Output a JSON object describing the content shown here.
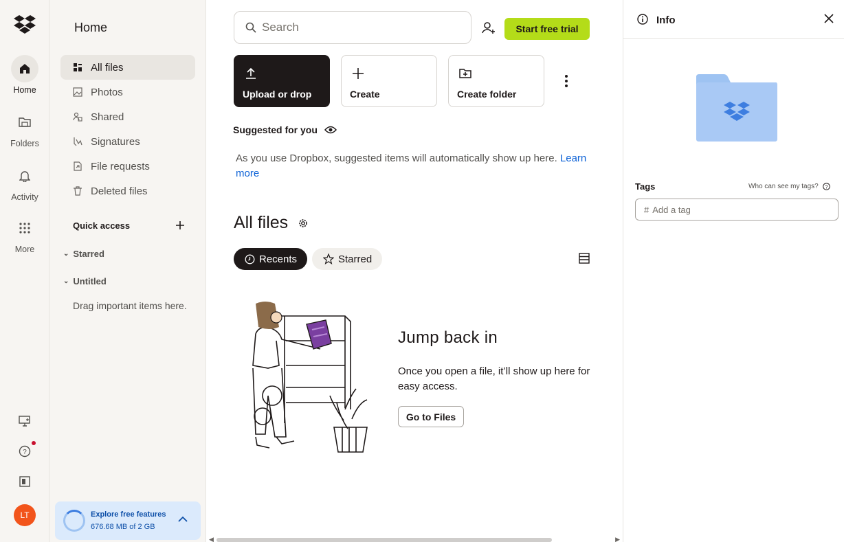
{
  "rail": {
    "items": [
      {
        "label": "Home",
        "icon": "home-icon"
      },
      {
        "label": "Folders",
        "icon": "folders-icon"
      },
      {
        "label": "Activity",
        "icon": "bell-icon"
      },
      {
        "label": "More",
        "icon": "grid-icon"
      }
    ],
    "avatar_initials": "LT"
  },
  "sidebar": {
    "title": "Home",
    "items": [
      {
        "label": "All files",
        "icon": "all-files-icon"
      },
      {
        "label": "Photos",
        "icon": "photo-icon"
      },
      {
        "label": "Shared",
        "icon": "shared-icon"
      },
      {
        "label": "Signatures",
        "icon": "signature-icon"
      },
      {
        "label": "File requests",
        "icon": "file-request-icon"
      },
      {
        "label": "Deleted files",
        "icon": "trash-icon"
      }
    ],
    "quick_access": "Quick access",
    "starred": "Starred",
    "untitled": "Untitled",
    "drag_hint": "Drag important items here.",
    "storage": {
      "title": "Explore free features",
      "usage": "676.68 MB of 2 GB"
    }
  },
  "header": {
    "search_placeholder": "Search",
    "trial_button": "Start free trial"
  },
  "actions": {
    "upload": "Upload or drop",
    "create": "Create",
    "create_folder": "Create folder"
  },
  "suggested": {
    "title": "Suggested for you",
    "text": "As you use Dropbox, suggested items will automatically show up here.",
    "link": "Learn more"
  },
  "files": {
    "title": "All files",
    "tabs": [
      "Recents",
      "Starred"
    ],
    "empty_title": "Jump back in",
    "empty_text": "Once you open a file, it’ll show up here for easy access.",
    "go_button": "Go to Files"
  },
  "info": {
    "title": "Info",
    "tags_label": "Tags",
    "who_can_see": "Who can see my tags?",
    "tag_prefix": "#",
    "tag_placeholder": "Add a tag"
  },
  "colors": {
    "accent": "#b4dc19",
    "dark": "#1e1919",
    "link": "#0d62d6",
    "folder": "#9ec3f2",
    "avatar": "#f2541b"
  }
}
